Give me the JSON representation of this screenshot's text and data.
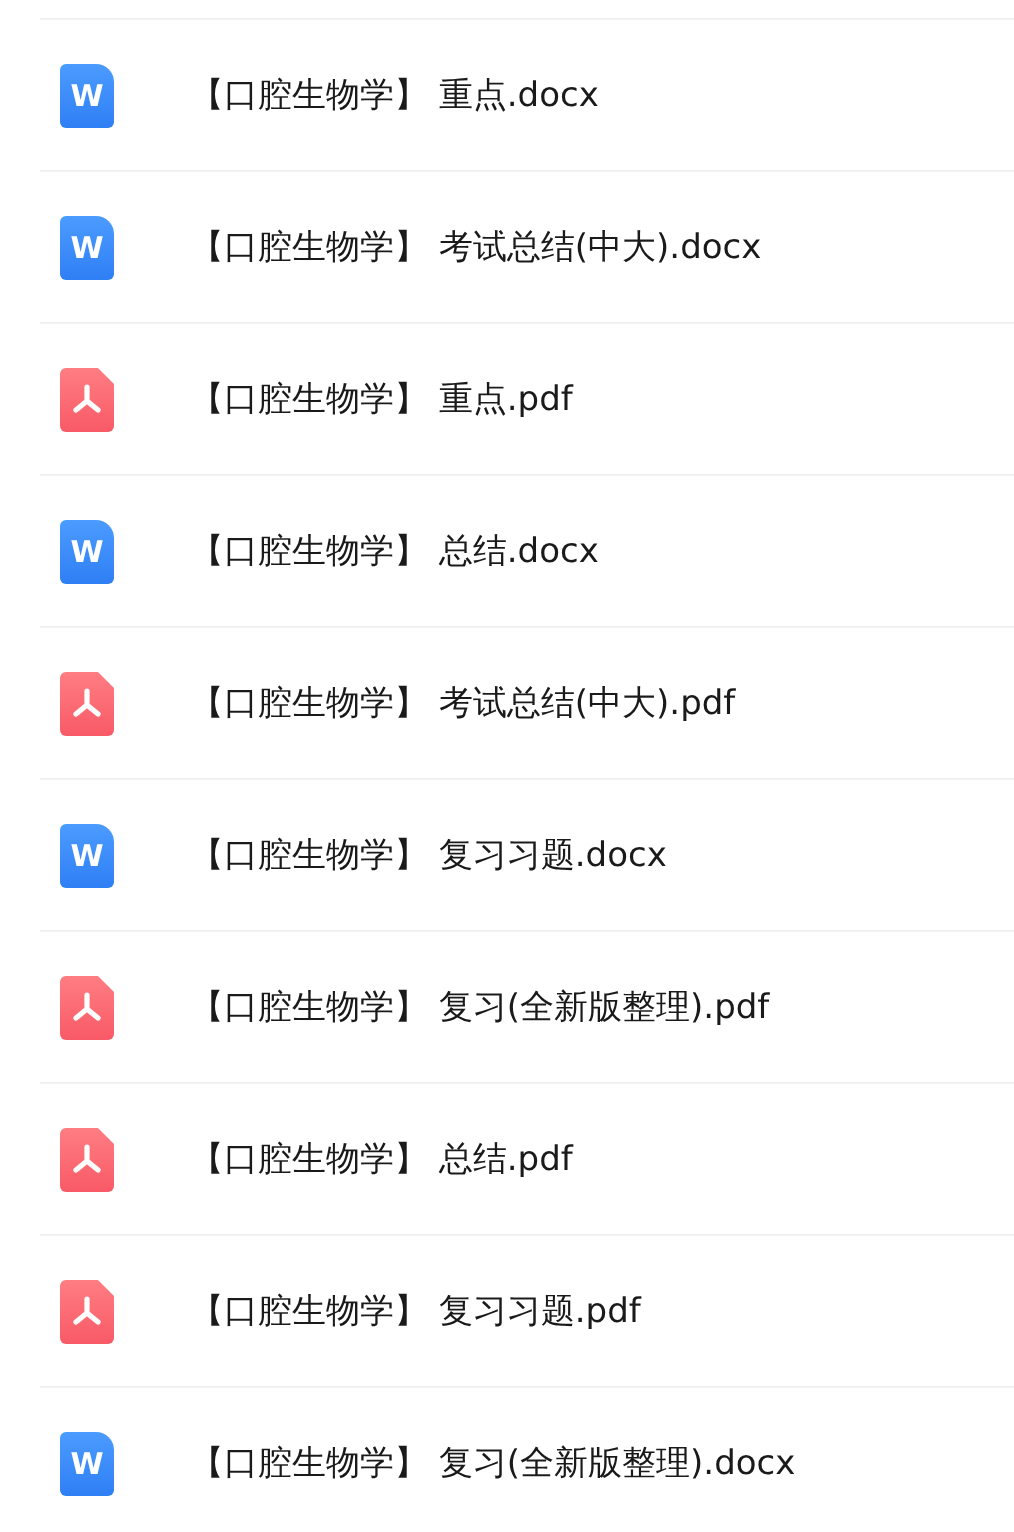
{
  "files": [
    {
      "kind": "docx",
      "icon_glyph": "W",
      "name": "【口腔生物学】 重点.docx"
    },
    {
      "kind": "docx",
      "icon_glyph": "W",
      "name": "【口腔生物学】 考试总结(中大).docx"
    },
    {
      "kind": "pdf",
      "name": "【口腔生物学】 重点.pdf"
    },
    {
      "kind": "docx",
      "icon_glyph": "W",
      "name": "【口腔生物学】 总结.docx"
    },
    {
      "kind": "pdf",
      "name": "【口腔生物学】 考试总结(中大).pdf"
    },
    {
      "kind": "docx",
      "icon_glyph": "W",
      "name": "【口腔生物学】 复习习题.docx"
    },
    {
      "kind": "pdf",
      "name": "【口腔生物学】 复习(全新版整理).pdf"
    },
    {
      "kind": "pdf",
      "name": "【口腔生物学】 总结.pdf"
    },
    {
      "kind": "pdf",
      "name": "【口腔生物学】 复习习题.pdf"
    },
    {
      "kind": "docx",
      "icon_glyph": "W",
      "name": "【口腔生物学】 复习(全新版整理).docx"
    }
  ]
}
